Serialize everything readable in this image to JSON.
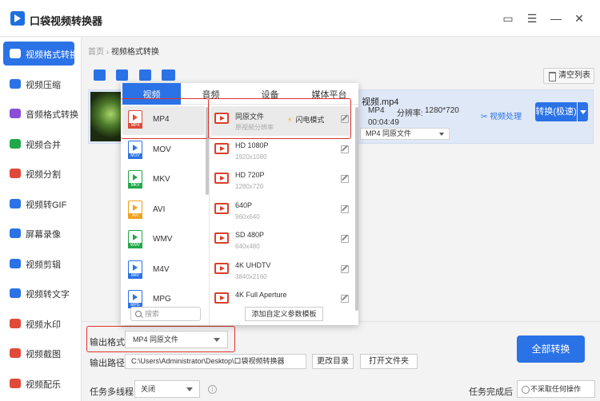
{
  "app": {
    "title": "口袋视频转换器"
  },
  "window": {
    "open_folder_icon": "folder-icon",
    "menu_icon": "menu-icon",
    "minimize": "—",
    "close": "✕"
  },
  "sidebar": {
    "items": [
      {
        "label": "视频格式转换",
        "color": "#2b72e6",
        "active": true
      },
      {
        "label": "视频压缩",
        "color": "#2b72e6"
      },
      {
        "label": "音频格式转换",
        "color": "#8a4fd6"
      },
      {
        "label": "视频合并",
        "color": "#22a84a"
      },
      {
        "label": "视频分割",
        "color": "#e04a3a"
      },
      {
        "label": "视频转GIF",
        "color": "#2b72e6"
      },
      {
        "label": "屏幕录像",
        "color": "#2b72e6"
      },
      {
        "label": "视频剪辑",
        "color": "#2b72e6"
      },
      {
        "label": "视频转文字",
        "color": "#2b72e6"
      },
      {
        "label": "视频水印",
        "color": "#e04a3a"
      },
      {
        "label": "视频截图",
        "color": "#e04a3a"
      },
      {
        "label": "视频配乐",
        "color": "#e04a3a"
      }
    ]
  },
  "breadcrumb": {
    "home": "首页",
    "sep": "›",
    "current": "视频格式转换"
  },
  "toolbar": {
    "clear_label": "清空列表"
  },
  "file": {
    "name": "视频.mp4",
    "format": "MP4",
    "resolution_label": "分辨率:",
    "resolution": "1280*720",
    "duration": "00:04:49",
    "output_select": "MP4  同原文件",
    "process_label": "视频处理",
    "convert_label": "转换(极速)"
  },
  "popup": {
    "tabs": [
      "视频",
      "音频",
      "设备",
      "媒体平台"
    ],
    "formats": [
      {
        "label": "MP4",
        "color": "#e04a3a",
        "selected": true
      },
      {
        "label": "MOV",
        "color": "#2b72e6"
      },
      {
        "label": "MKV",
        "color": "#22a84a"
      },
      {
        "label": "AVI",
        "color": "#f0a01c"
      },
      {
        "label": "WMV",
        "color": "#22a84a"
      },
      {
        "label": "M4V",
        "color": "#2b72e6"
      },
      {
        "label": "MPG",
        "color": "#2b72e6"
      }
    ],
    "search_placeholder": "搜索",
    "resolutions": [
      {
        "name": "同原文件",
        "sub": "原视频分辨率",
        "flash": "闪电模式",
        "selected": true
      },
      {
        "name": "HD 1080P",
        "sub": "1920x1080"
      },
      {
        "name": "HD 720P",
        "sub": "1280x720"
      },
      {
        "name": "640P",
        "sub": "960x640"
      },
      {
        "name": "SD 480P",
        "sub": "640x480"
      },
      {
        "name": "4K UHDTV",
        "sub": "3840x2160"
      },
      {
        "name": "4K Full Aperture",
        "sub": ""
      }
    ],
    "custom_label": "添加自定义参数模板"
  },
  "bottom": {
    "output_format_label": "输出格式:",
    "output_format_value": "MP4  同原文件",
    "output_path_label": "输出路径:",
    "output_path_value": "C:\\Users\\Administrator\\Desktop\\口袋视频转换器",
    "change_dir_label": "更改目录",
    "open_folder_label": "打开文件夹",
    "convert_all_label": "全部转换",
    "multi_thread_label": "任务多线程",
    "multi_thread_value": "关闭",
    "done_label": "任务完成后",
    "done_value": "不采取任何操作"
  }
}
